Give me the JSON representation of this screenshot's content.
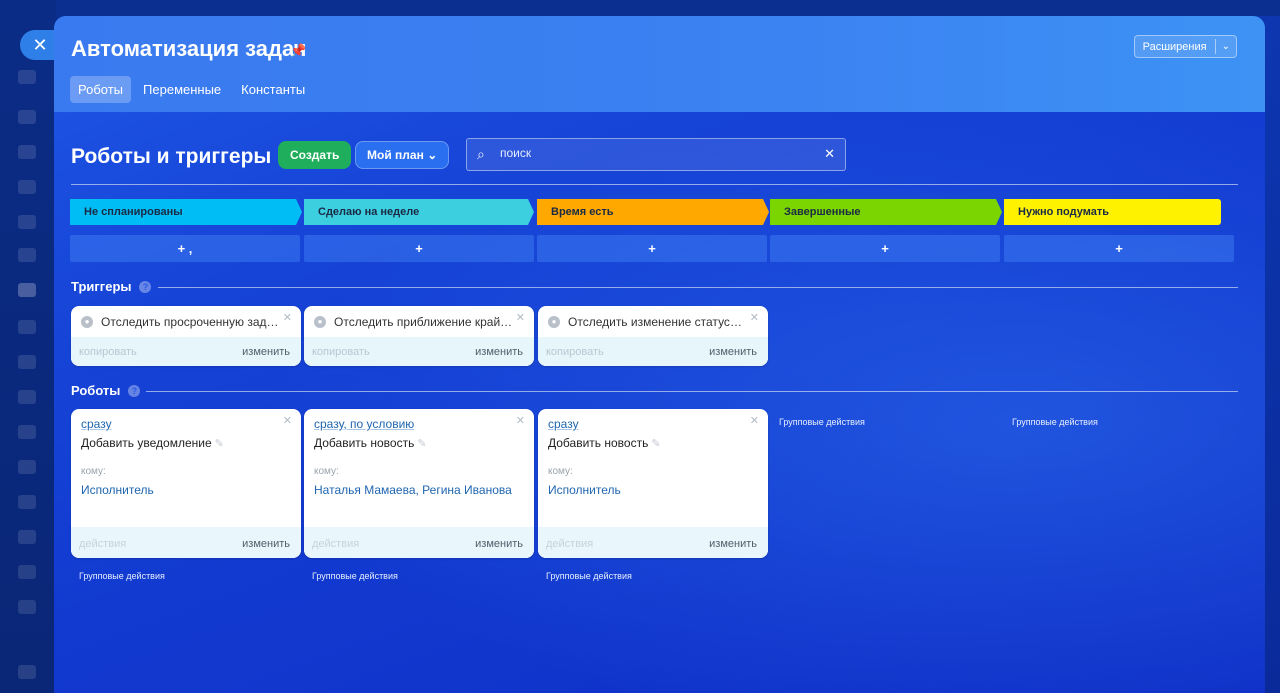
{
  "page": {
    "title": "Автоматизация задач",
    "tabs": [
      {
        "label": "Роботы",
        "active": true
      },
      {
        "label": "Переменные",
        "active": false
      },
      {
        "label": "Константы",
        "active": false
      }
    ],
    "extensions_label": "Расширения"
  },
  "toolbar": {
    "section_title": "Роботы и триггеры",
    "create_label": "Создать",
    "plan_label": "Мой план",
    "search_placeholder": "поиск"
  },
  "stages": [
    {
      "label": "Не спланированы",
      "color": "#00bdf5"
    },
    {
      "label": "Сделаю на неделе",
      "color": "#3ccfe0"
    },
    {
      "label": "Время есть",
      "color": "#ffa800"
    },
    {
      "label": "Завершенные",
      "color": "#7bd500"
    },
    {
      "label": "Нужно подумать",
      "color": "#fff200"
    }
  ],
  "add_labels": [
    "+ ,",
    "+",
    "+",
    "+",
    "+"
  ],
  "triggers": {
    "label": "Триггеры",
    "items": [
      {
        "text": "Отследить просроченную задачу",
        "copy": "копировать",
        "edit": "изменить"
      },
      {
        "text": "Отследить приближение крайне…",
        "copy": "копировать",
        "edit": "изменить"
      },
      {
        "text": "Отследить изменение статуса за…",
        "copy": "копировать",
        "edit": "изменить"
      }
    ]
  },
  "robots": {
    "label": "Роботы",
    "items": [
      {
        "when": "сразу",
        "name": "Добавить уведомление",
        "whom_label": "кому:",
        "whom": "Исполнитель",
        "actions": "действия",
        "edit": "изменить"
      },
      {
        "when": "сразу, по условию",
        "name": "Добавить новость",
        "whom_label": "кому:",
        "whom": "Наталья Мамаева, Регина Иванова",
        "actions": "действия",
        "edit": "изменить"
      },
      {
        "when": "сразу",
        "name": "Добавить новость",
        "whom_label": "кому:",
        "whom": "Исполнитель",
        "actions": "действия",
        "edit": "изменить"
      }
    ],
    "group_actions": "Групповые действия"
  },
  "icons": {
    "close": "close-icon",
    "pin": "pin-icon",
    "search": "search-icon",
    "help": "help-icon",
    "pencil": "pencil-icon",
    "trigger": "trigger-icon"
  }
}
